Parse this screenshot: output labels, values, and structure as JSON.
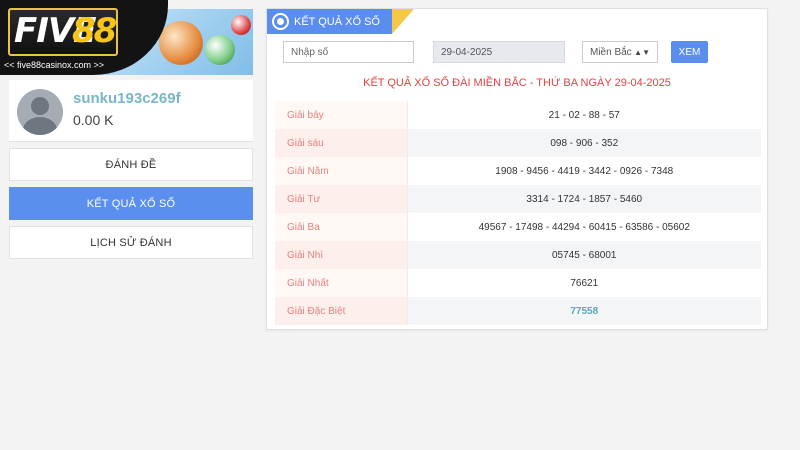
{
  "brand": {
    "word": "FIVE",
    "number": "88",
    "url": "<< five88casinox.com >>"
  },
  "user": {
    "username": "sunku193c269f",
    "balance": "0.00 K"
  },
  "sidebar": {
    "items": [
      {
        "label": "ĐÁNH ĐỀ",
        "active": false
      },
      {
        "label": "KẾT QUẢ XỔ SỐ",
        "active": true
      },
      {
        "label": "LỊCH SỬ ĐÁNH",
        "active": false
      }
    ]
  },
  "panel": {
    "title": "KẾT QUẢ XỔ SỐ",
    "number_input_placeholder": "Nhập số",
    "date_value": "29-04-2025",
    "region_value": "Miền Bắc",
    "search_label": "XEM",
    "result_title": "KẾT QUẢ XỔ SỐ ĐÀI MIỀN BẮC - THỨ BA NGÀY 29-04-2025"
  },
  "results": [
    {
      "prize": "Giải bảy",
      "numbers": "21 - 02 - 88 - 57"
    },
    {
      "prize": "Giải sáu",
      "numbers": "098 - 906 - 352"
    },
    {
      "prize": "Giải Năm",
      "numbers": "1908 - 9456 - 4419 - 3442 - 0926 - 7348"
    },
    {
      "prize": "Giải Tư",
      "numbers": "3314 - 1724 - 1857 - 5460"
    },
    {
      "prize": "Giải Ba",
      "numbers": "49567 - 17498 - 44294 - 60415 - 63586 - 05602"
    },
    {
      "prize": "Giải Nhì",
      "numbers": "05745 - 68001"
    },
    {
      "prize": "Giải Nhất",
      "numbers": "76621"
    },
    {
      "prize": "Giải Đặc Biệt",
      "numbers": "77558"
    }
  ],
  "colors": {
    "accent": "#5b8def",
    "title_red": "#e34242",
    "prize_text": "#e4827f",
    "special_number": "#5aa7b9",
    "ribbon_yellow": "#f5c84a"
  }
}
